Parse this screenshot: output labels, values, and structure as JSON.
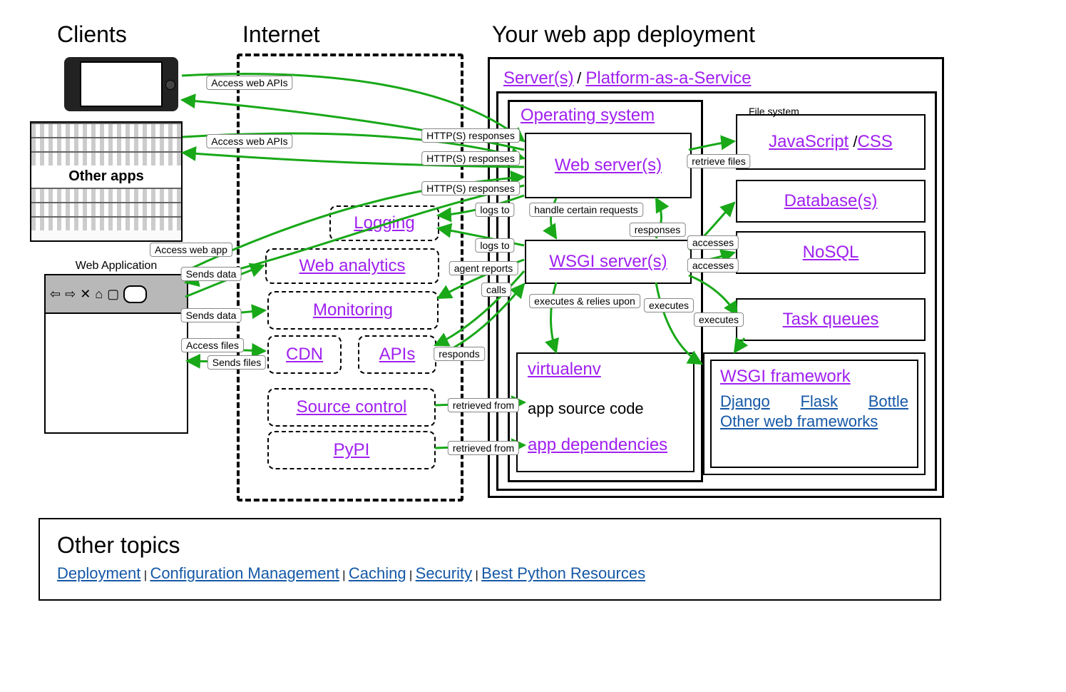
{
  "columns": {
    "clients": "Clients",
    "internet": "Internet",
    "deployment": "Your web app deployment"
  },
  "clients": {
    "other_apps": "Other apps",
    "web_application": "Web Application"
  },
  "deploy": {
    "servers": "Server(s)",
    "paas": "Platform-as-a-Service",
    "sep": " / ",
    "os": "Operating system",
    "boxes": {
      "web_server": "Web server(s)",
      "wsgi": "WSGI server(s)",
      "virtualenv": "virtualenv",
      "app_source": "app source code",
      "app_deps": "app dependencies",
      "js": "JavaScript",
      "css": "CSS",
      "db": "Database(s)",
      "nosql": "NoSQL",
      "tq": "Task queues",
      "wsgi_fw": "WSGI framework",
      "fs_title": "File system"
    },
    "fw_links": [
      "Django",
      "Flask",
      "Bottle",
      "Other web frameworks"
    ]
  },
  "internet": {
    "logging": "Logging",
    "analytics": "Web analytics",
    "monitoring": "Monitoring",
    "cdn": "CDN",
    "apis": "APIs",
    "src": "Source control",
    "pypi": "PyPI"
  },
  "edges": {
    "access_apis": "Access web APIs",
    "access_webapp": "Access web app",
    "http_resp": "HTTP(S) responses",
    "sends_data": "Sends data",
    "access_files": "Access files",
    "sends_files": "Sends files",
    "logs_to": "logs to",
    "agent_reports": "agent reports",
    "responds": "responds",
    "calls": "calls",
    "retrieved_from": "retrieved from",
    "handle_requests": "handle certain requests",
    "responses": "responses",
    "accesses": "accesses",
    "retrieve_files": "retrieve files",
    "executes_relies": "executes & relies upon",
    "executes": "executes"
  },
  "footer": {
    "title": "Other topics",
    "links": [
      "Deployment",
      "Configuration Management",
      "Caching",
      "Security",
      "Best Python Resources"
    ],
    "sep": " | "
  }
}
